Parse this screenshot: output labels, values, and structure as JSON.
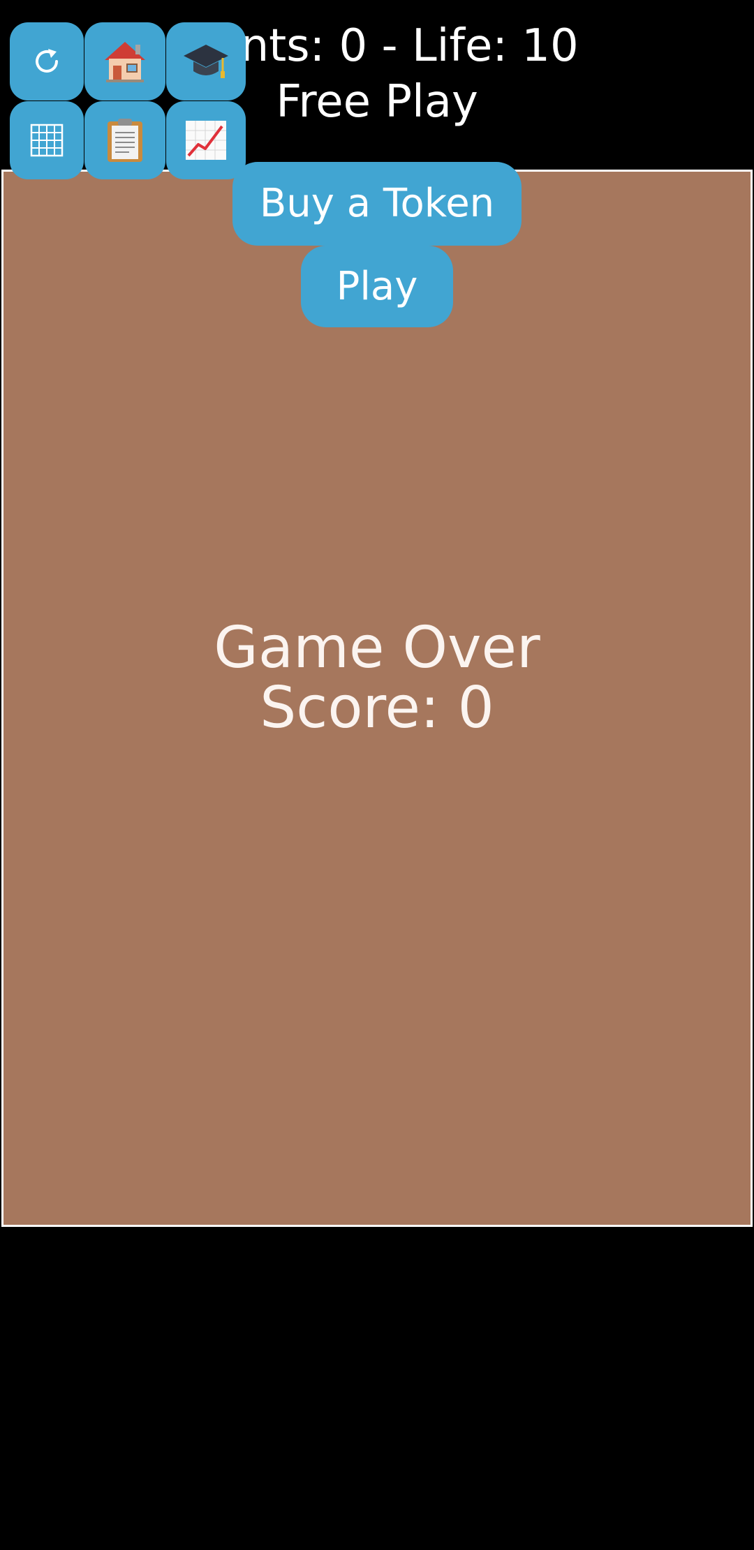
{
  "header": {
    "status": "Points: 0 - Life: 10",
    "mode": "Free Play"
  },
  "buttons": {
    "buy_token": "Buy a Token",
    "play": "Play"
  },
  "toolbar": {
    "icons": [
      "refresh-icon",
      "home-icon",
      "graduation-cap-icon",
      "grid-icon",
      "clipboard-icon",
      "chart-increasing-icon"
    ]
  },
  "game": {
    "over_title": "Game Over",
    "over_score": "Score: 0"
  },
  "colors": {
    "background": "#000000",
    "board": "#a6775d",
    "button": "#41a5d2",
    "text": "#ffffff"
  }
}
